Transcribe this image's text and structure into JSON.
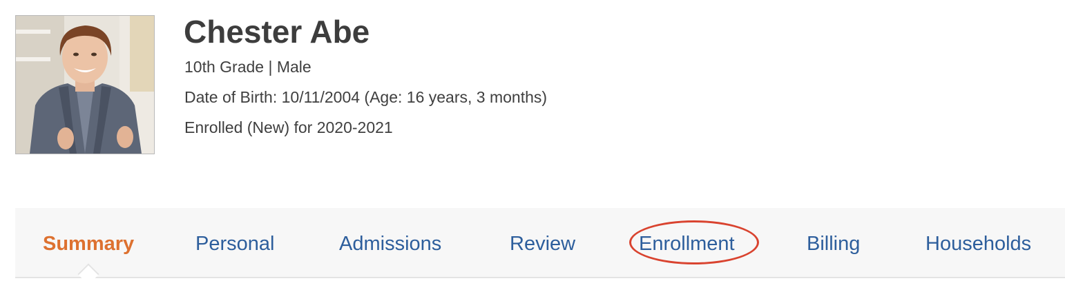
{
  "student": {
    "name": "Chester Abe",
    "grade_gender": "10th Grade | Male",
    "dob_line": "Date of Birth: 10/11/2004 (Age: 16 years, 3 months)",
    "enrollment_line": "Enrolled (New) for 2020-2021"
  },
  "tabs": [
    {
      "label": "Summary",
      "active": true
    },
    {
      "label": "Personal",
      "active": false
    },
    {
      "label": "Admissions",
      "active": false
    },
    {
      "label": "Review",
      "active": false
    },
    {
      "label": "Enrollment",
      "active": false,
      "highlighted": true
    },
    {
      "label": "Billing",
      "active": false
    },
    {
      "label": "Households",
      "active": false
    }
  ],
  "colors": {
    "active_tab": "#dd7130",
    "tab_link": "#2d5e9c",
    "highlight_annotation": "#d9432f",
    "tab_bar_bg": "#f7f7f7"
  },
  "icons": {
    "profile_photo": "student-avatar-photo"
  }
}
